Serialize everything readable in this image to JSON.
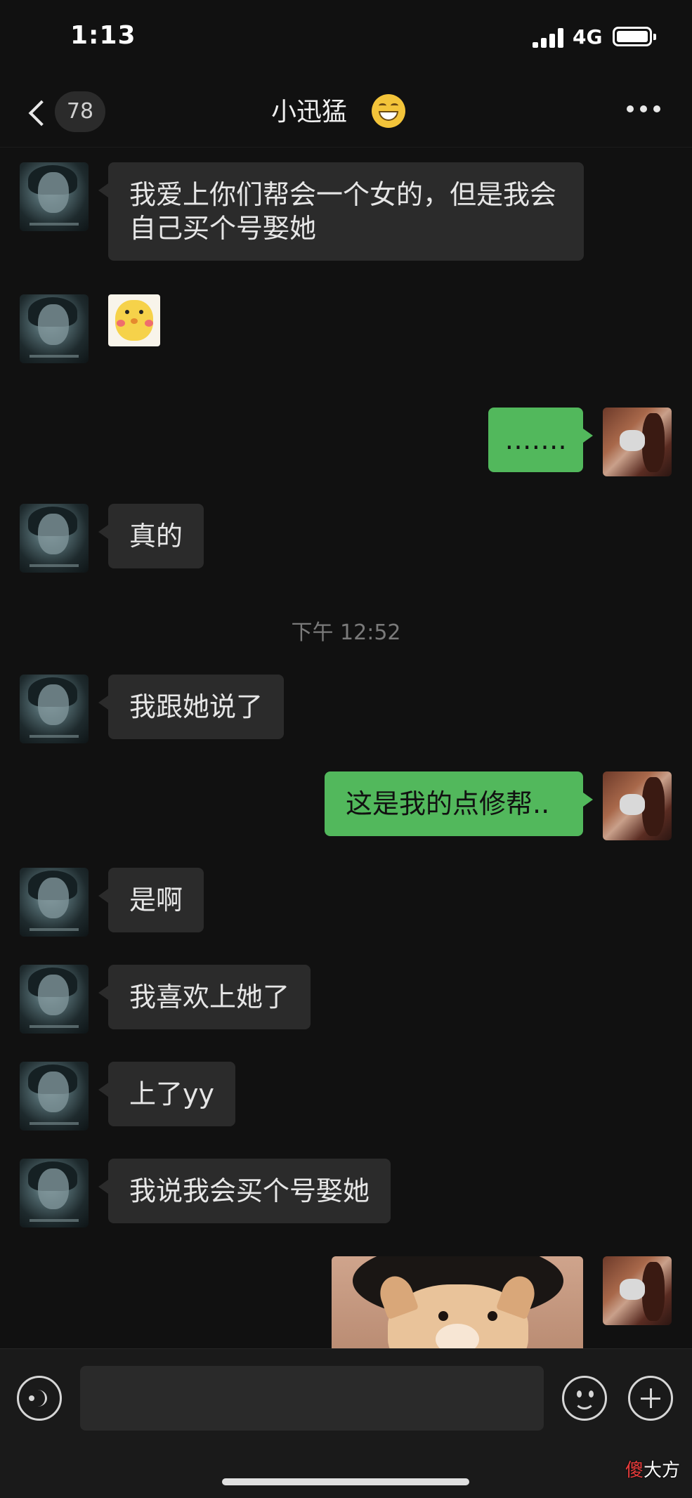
{
  "status_bar": {
    "time": "1:13",
    "network": "4G"
  },
  "nav": {
    "unread_count": "78",
    "title": "小迅猛"
  },
  "messages": [
    {
      "side": "in",
      "type": "text",
      "text": "我爱上你们帮会一个女的，但是我会自己买个号娶她"
    },
    {
      "side": "in",
      "type": "sticker",
      "sticker": "yellow-chick-sticker"
    },
    {
      "side": "out",
      "type": "text",
      "text": "……."
    },
    {
      "side": "in",
      "type": "text",
      "text": "真的"
    },
    {
      "side": "system",
      "type": "time",
      "text": "下午 12:52"
    },
    {
      "side": "in",
      "type": "text",
      "text": "我跟她说了"
    },
    {
      "side": "out",
      "type": "text",
      "text": "这是我的点修帮.."
    },
    {
      "side": "in",
      "type": "text",
      "text": "是啊"
    },
    {
      "side": "in",
      "type": "text",
      "text": "我喜欢上她了"
    },
    {
      "side": "in",
      "type": "text",
      "text": "上了yy"
    },
    {
      "side": "in",
      "type": "text",
      "text": "我说我会买个号娶她"
    },
    {
      "side": "out",
      "type": "image",
      "image": "corgi-photo"
    }
  ],
  "input": {
    "placeholder": ""
  },
  "watermark": {
    "first": "傻",
    "rest": "大方"
  }
}
